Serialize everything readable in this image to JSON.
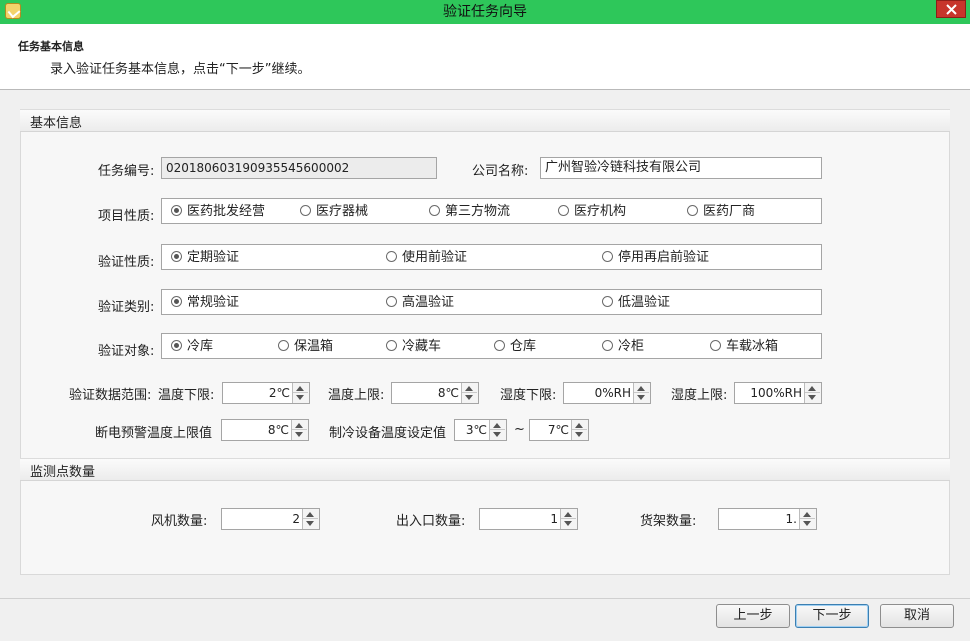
{
  "window": {
    "title": "验证任务向导"
  },
  "header": {
    "title": "任务基本信息",
    "description": "录入验证任务基本信息，点击“下一步”继续。"
  },
  "basic": {
    "section_title": "基本信息",
    "task_no_label": "任务编号:",
    "task_no_value": "020180603190935545600002",
    "company_label": "公司名称:",
    "company_value": "广州智验冷链科技有限公司",
    "project_nature_label": "项目性质:",
    "project_nature_options": [
      "医药批发经营",
      "医疗器械",
      "第三方物流",
      "医疗机构",
      "医药厂商"
    ],
    "verify_nature_label": "验证性质:",
    "verify_nature_options": [
      "定期验证",
      "使用前验证",
      "停用再启前验证"
    ],
    "verify_type_label": "验证类别:",
    "verify_type_options": [
      "常规验证",
      "高温验证",
      "低温验证"
    ],
    "verify_object_label": "验证对象:",
    "verify_object_options": [
      "冷库",
      "保温箱",
      "冷藏车",
      "仓库",
      "冷柜",
      "车载冰箱"
    ],
    "data_range_label": "验证数据范围:",
    "temp_low_label": "温度下限:",
    "temp_low_value": "2℃",
    "temp_high_label": "温度上限:",
    "temp_high_value": "8℃",
    "hum_low_label": "湿度下限:",
    "hum_low_value": "0%RH",
    "hum_high_label": "湿度上限:",
    "hum_high_value": "100%RH",
    "power_alarm_label": "断电预警温度上限值",
    "power_alarm_value": "8℃",
    "fridge_set_label": "制冷设备温度设定值",
    "fridge_set_min": "3℃",
    "tilde": "~",
    "fridge_set_max": "7℃"
  },
  "monitor": {
    "section_title": "监测点数量",
    "fan_label": "风机数量:",
    "fan_value": "2",
    "door_label": "出入口数量:",
    "door_value": "1",
    "shelf_label": "货架数量:",
    "shelf_value": "1."
  },
  "footer": {
    "prev": "上一步",
    "next": "下一步",
    "cancel": "取消"
  }
}
